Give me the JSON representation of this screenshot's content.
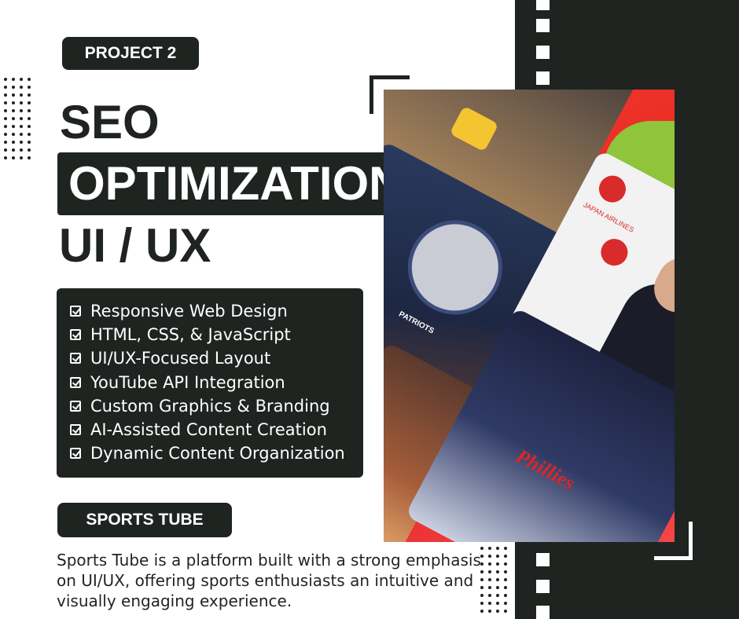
{
  "badge": "PROJECT 2",
  "headline": {
    "line1": "SEO",
    "line2": "OPTIMIZATION",
    "line3": "UI / UX"
  },
  "features": [
    "Responsive Web Design",
    "HTML, CSS, & JavaScript",
    "UI/UX-Focused Layout",
    "YouTube API Integration",
    "Custom Graphics & Branding",
    "AI-Assisted Content Creation",
    "Dynamic Content Organization"
  ],
  "project_name": "SPORTS TUBE",
  "description": "Sports Tube is a platform built with a strong emphasis on UI/UX, offering sports enthusiasts an intuitive and visually engaging experience.",
  "collage": {
    "jersey_text": "PATRIOTS",
    "phillies_text": "Phillies",
    "airline_text": "JAPAN AIRLINES"
  },
  "colors": {
    "dark": "#1f2421",
    "accent_red": "#ee2a2a",
    "white": "#ffffff"
  }
}
